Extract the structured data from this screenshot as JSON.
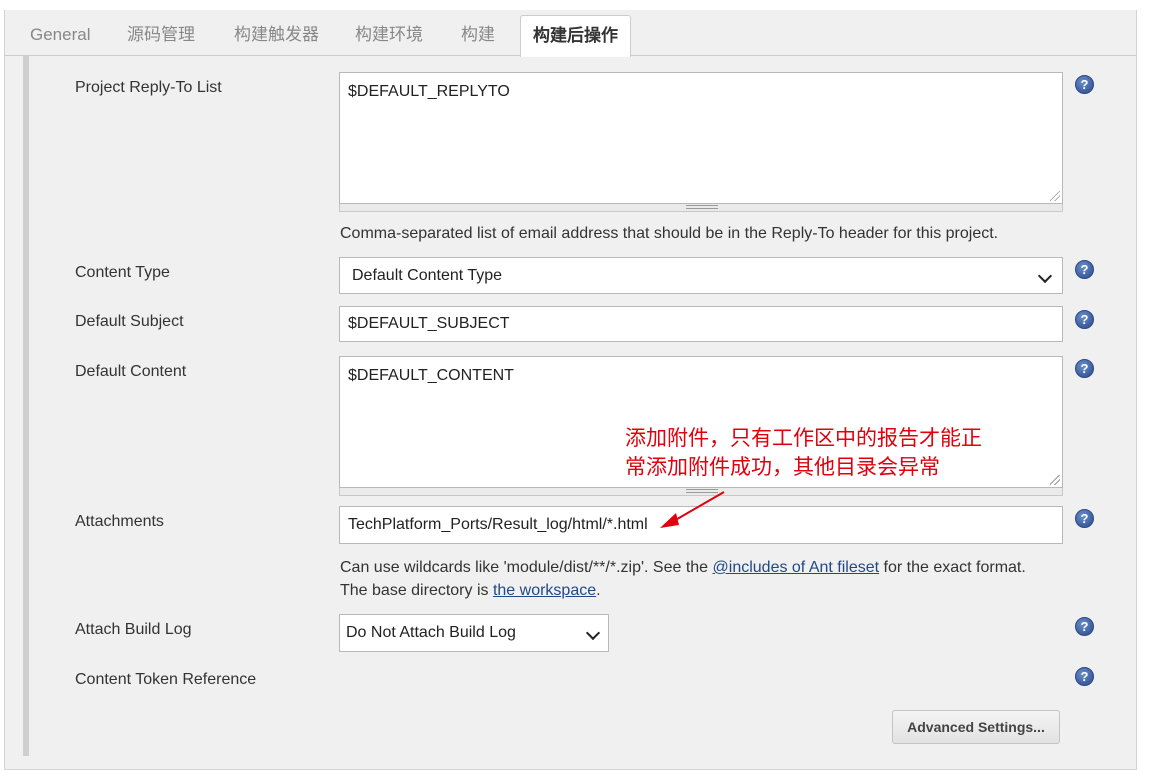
{
  "tabs": [
    {
      "label": "General"
    },
    {
      "label": "源码管理"
    },
    {
      "label": "构建触发器"
    },
    {
      "label": "构建环境"
    },
    {
      "label": "构建"
    },
    {
      "label": "构建后操作",
      "active": true
    }
  ],
  "form": {
    "reply_to": {
      "label": "Project Reply-To List",
      "value": "$DEFAULT_REPLYTO",
      "help": "Comma-separated list of email address that should be in the Reply-To header for this project."
    },
    "content_type": {
      "label": "Content Type",
      "selected": "Default Content Type"
    },
    "default_subject": {
      "label": "Default Subject",
      "value": "$DEFAULT_SUBJECT"
    },
    "default_content": {
      "label": "Default Content",
      "value": "$DEFAULT_CONTENT"
    },
    "attachments": {
      "label": "Attachments",
      "value": "TechPlatform_Ports/Result_log/html/*.html",
      "help_line1_before": "Can use wildcards like 'module/dist/**/*.zip'. See the ",
      "help_line1_link": "@includes of Ant fileset",
      "help_line1_after": " for the exact format.",
      "help_line2_before": "The base directory is ",
      "help_line2_link": "the workspace",
      "help_line2_after": "."
    },
    "attach_build_log": {
      "label": "Attach Build Log",
      "selected": "Do Not Attach Build Log"
    },
    "content_token_reference": {
      "label": "Content Token Reference"
    },
    "advanced_button": "Advanced Settings..."
  },
  "help_icon_glyph": "?",
  "annotation": {
    "line1": "添加附件，只有工作区中的报告才能正",
    "line2": "常添加附件成功，其他目录会异常",
    "color": "#e0000e"
  }
}
